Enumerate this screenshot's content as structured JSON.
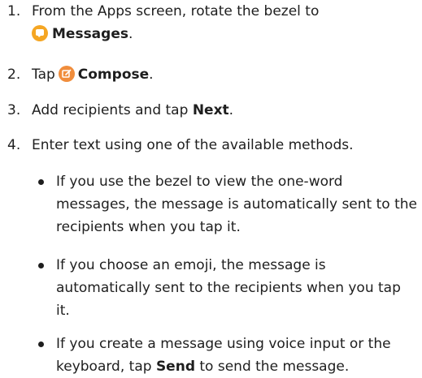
{
  "steps": [
    {
      "number": "1.",
      "text_before": "From the Apps screen, rotate the bezel to",
      "app_name": "Messages",
      "text_after": ".",
      "icon": "messages-app-icon"
    },
    {
      "number": "2.",
      "text_before": "Tap",
      "button_name": "Compose",
      "text_after": ".",
      "icon": "compose-icon"
    },
    {
      "number": "3.",
      "text_before": "Add recipients and tap ",
      "button_name": "Next",
      "text_after": "."
    },
    {
      "number": "4.",
      "text": "Enter text using one of the available methods."
    }
  ],
  "bullets": [
    {
      "text": "If you use the bezel to view the one-word messages, the message is automatically sent to the recipients when you tap it."
    },
    {
      "text": "If you choose an emoji, the message is automatically sent to the recipients when you tap it."
    },
    {
      "text_before": "If you create a message using voice input or the keyboard, tap ",
      "button_name": "Send",
      "text_after": " to send the message."
    }
  ],
  "colors": {
    "text": "#1e1e1e",
    "messages_icon": "#f5a623",
    "compose_icon": "#f08d3c"
  }
}
